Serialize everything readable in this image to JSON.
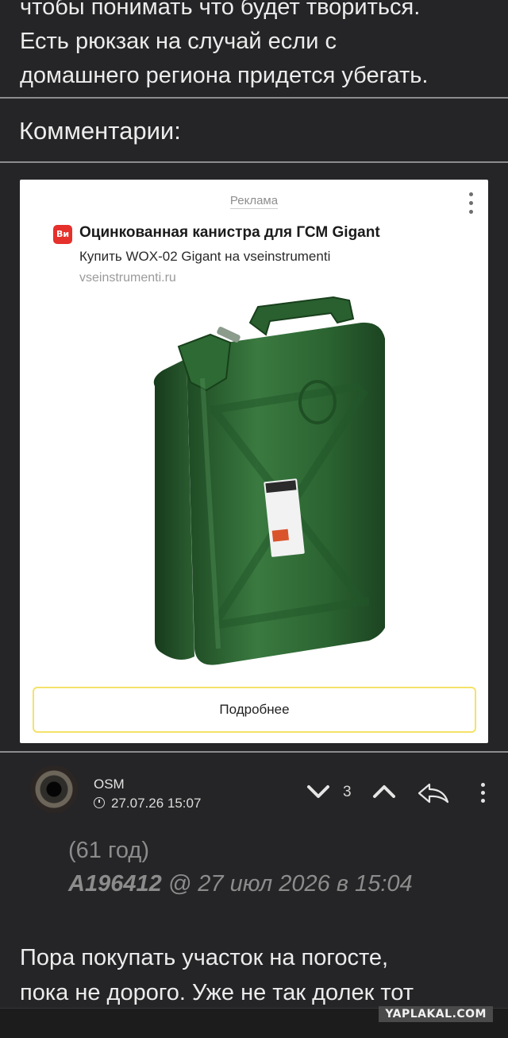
{
  "post": {
    "lines": [
      "чтобы понимать что будет твориться.",
      "Есть рюкзак на случай если с",
      "домашнего региона придется убегать."
    ]
  },
  "comments_section": {
    "title": "Комментарии:"
  },
  "ad": {
    "label": "Реклама",
    "favicon_text": "Ви",
    "title": "Оцинкованная канистра для ГСМ Gigant",
    "subtitle": "Купить WOX-02 Gigant на vseinstrumenti",
    "domain": "vseinstrumenti.ru",
    "button_label": "Подробнее",
    "image_icon": "green-jerry-can",
    "colors": {
      "favicon": "#e5302b",
      "button_border": "#f5e26a",
      "can": "#2f6b35"
    }
  },
  "comment": {
    "author": "OSM",
    "date": "27.07.26 15:07",
    "vote_count": "3",
    "quote_age": "(61 год)",
    "quote_user": "A196412",
    "quote_meta": " @ 27 июл 2026 в 15:04",
    "text_lines": [
      "Пора покупать участок на погосте,",
      "пока не дорого. Уже не так долек тот"
    ]
  },
  "watermark": "YAPLAKAL.COM"
}
